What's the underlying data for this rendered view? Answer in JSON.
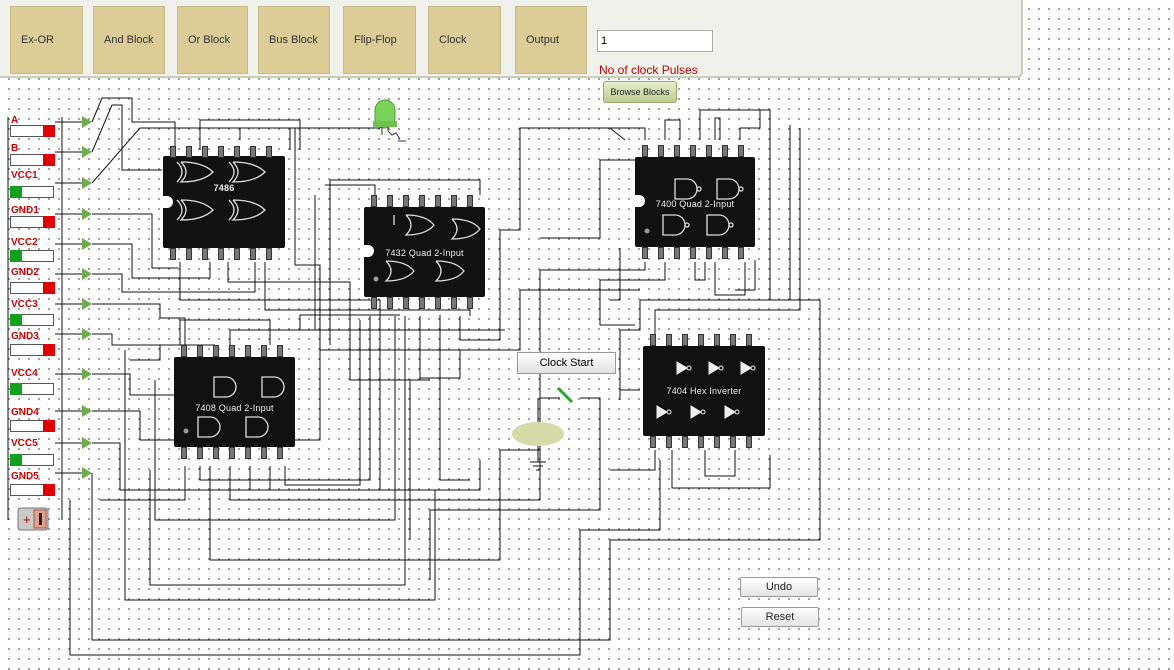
{
  "toolbar": {
    "buttons": [
      {
        "label": "Ex-OR"
      },
      {
        "label": "And Block"
      },
      {
        "label": "Or Block"
      },
      {
        "label": "Bus Block"
      },
      {
        "label": "Flip-Flop"
      },
      {
        "label": "Clock"
      },
      {
        "label": "Output"
      }
    ],
    "clock_pulses_value": "1",
    "clock_pulses_label": "No of clock Pulses",
    "browse_label": "Browse Blocks"
  },
  "inputs": [
    {
      "label": "A",
      "state": "low"
    },
    {
      "label": "B",
      "state": "low"
    },
    {
      "label": "VCC1",
      "state": "high"
    },
    {
      "label": "GND1",
      "state": "low"
    },
    {
      "label": "VCC2",
      "state": "high"
    },
    {
      "label": "GND2",
      "state": "low"
    },
    {
      "label": "VCC3",
      "state": "high"
    },
    {
      "label": "GND3",
      "state": "low"
    },
    {
      "label": "VCC4",
      "state": "high"
    },
    {
      "label": "GND4",
      "state": "low"
    },
    {
      "label": "VCC5",
      "state": "high"
    },
    {
      "label": "GND5",
      "state": "low"
    }
  ],
  "chips": {
    "c7486": {
      "label": "7486"
    },
    "c7432": {
      "label": "7432 Quad 2-Input"
    },
    "c7400": {
      "label": "7400 Quad 2-Input"
    },
    "c7408": {
      "label": "7408 Quad 2-Input"
    },
    "c7404": {
      "label": "7404 Hex Inverter"
    }
  },
  "clock": {
    "start_label": "Clock Start"
  },
  "controls": {
    "undo_label": "Undo",
    "reset_label": "Reset"
  },
  "colors": {
    "switch_on": "#13a01f",
    "switch_off": "#e00000",
    "label_red": "#d00000",
    "toolbar_button": "#dccd98"
  }
}
